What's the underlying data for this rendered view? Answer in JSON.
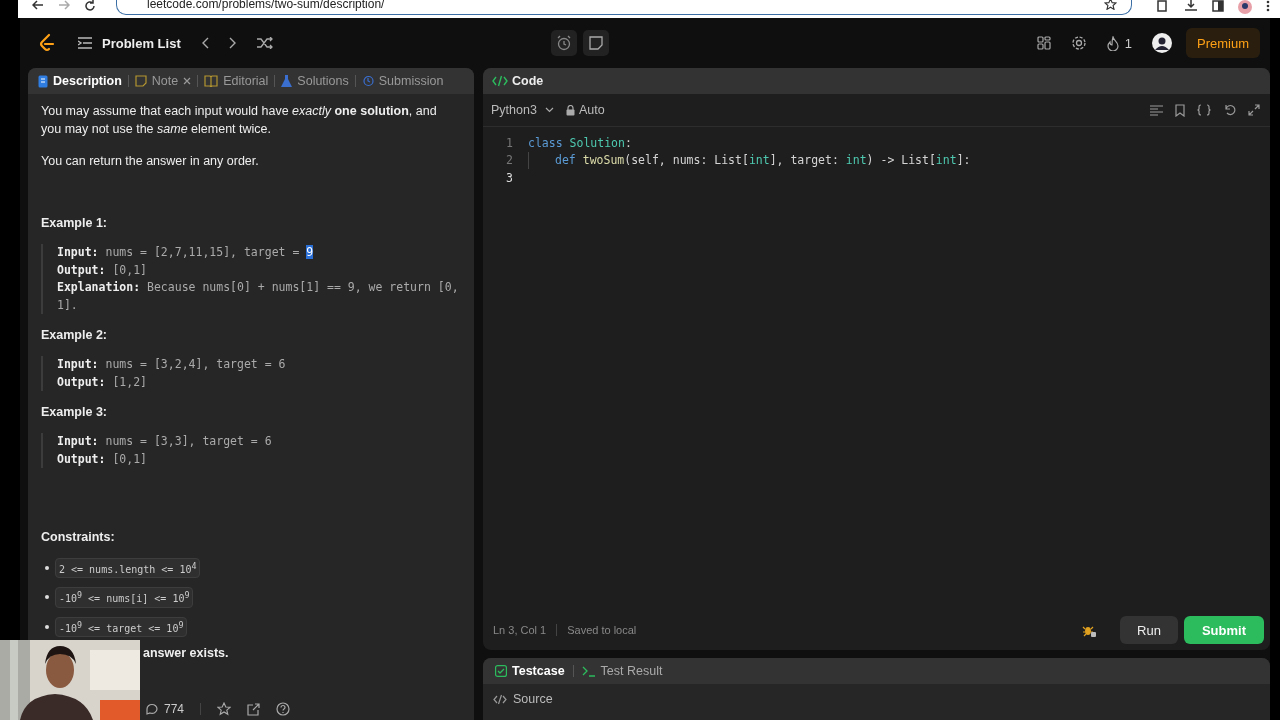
{
  "browser": {
    "url": "leetcode.com/problems/two-sum/description/"
  },
  "nav": {
    "problem_list": "Problem List",
    "streak": "1",
    "premium": "Premium"
  },
  "tabs": [
    {
      "label": "Description",
      "selected": true,
      "closable": false
    },
    {
      "label": "Note",
      "selected": false,
      "closable": true
    },
    {
      "label": "Editorial",
      "selected": false,
      "closable": false
    },
    {
      "label": "Solutions",
      "selected": false,
      "closable": false
    },
    {
      "label": "Submission",
      "selected": false,
      "closable": false
    }
  ],
  "description": {
    "paragraphs": [
      "You may assume that each input would have *exactly* **one solution**, and you may not use the *same* element twice.",
      "You can return the answer in any order."
    ],
    "examples": [
      {
        "title": "Example 1:",
        "lines": [
          {
            "label": "Input:",
            "value": "nums = [2,7,11,15], target = ",
            "selected_text": "9"
          },
          {
            "label": "Output:",
            "value": "[0,1]"
          },
          {
            "label": "Explanation:",
            "value": "Because nums[0] + nums[1] == 9, we return [0, 1]."
          }
        ]
      },
      {
        "title": "Example 2:",
        "lines": [
          {
            "label": "Input:",
            "value": "nums = [3,2,4], target = 6"
          },
          {
            "label": "Output:",
            "value": "[1,2]"
          }
        ]
      },
      {
        "title": "Example 3:",
        "lines": [
          {
            "label": "Input:",
            "value": "nums = [3,3], target = 6"
          },
          {
            "label": "Output:",
            "value": "[0,1]"
          }
        ]
      }
    ],
    "constraints_title": "Constraints:",
    "constraints": [
      "2 <= nums.length <= 10$^{4}$",
      "-10$^{9}$ <= nums[i] <= 10$^{9}$",
      "-10$^{9}$ <= target <= 10$^{9}$"
    ],
    "partial_note": "answer exists.",
    "comments": "774"
  },
  "editor": {
    "title": "Code",
    "language": "Python3",
    "mode": "Auto",
    "lines": [
      {
        "number": "1",
        "tokens": [
          {
            "kind": "keyword",
            "text": "class "
          },
          {
            "kind": "class",
            "text": "Solution"
          },
          {
            "kind": "plain",
            "text": ":"
          }
        ]
      },
      {
        "number": "2",
        "indent": true,
        "tokens": [
          {
            "kind": "keyword",
            "text": "def "
          },
          {
            "kind": "func",
            "text": "twoSum"
          },
          {
            "kind": "plain",
            "text": "(self, nums: List["
          },
          {
            "kind": "type",
            "text": "int"
          },
          {
            "kind": "plain",
            "text": "], target: "
          },
          {
            "kind": "type",
            "text": "int"
          },
          {
            "kind": "plain",
            "text": ") -> List["
          },
          {
            "kind": "type",
            "text": "int"
          },
          {
            "kind": "plain",
            "text": "]:"
          }
        ]
      },
      {
        "number": "3"
      }
    ],
    "position": "Ln 3, Col 1",
    "saved": "Saved to local",
    "run": "Run",
    "submit": "Submit"
  },
  "bottom": {
    "tabs": [
      {
        "label": "Testcase",
        "selected": true
      },
      {
        "label": "Test Result",
        "selected": false
      }
    ],
    "source": "Source"
  }
}
